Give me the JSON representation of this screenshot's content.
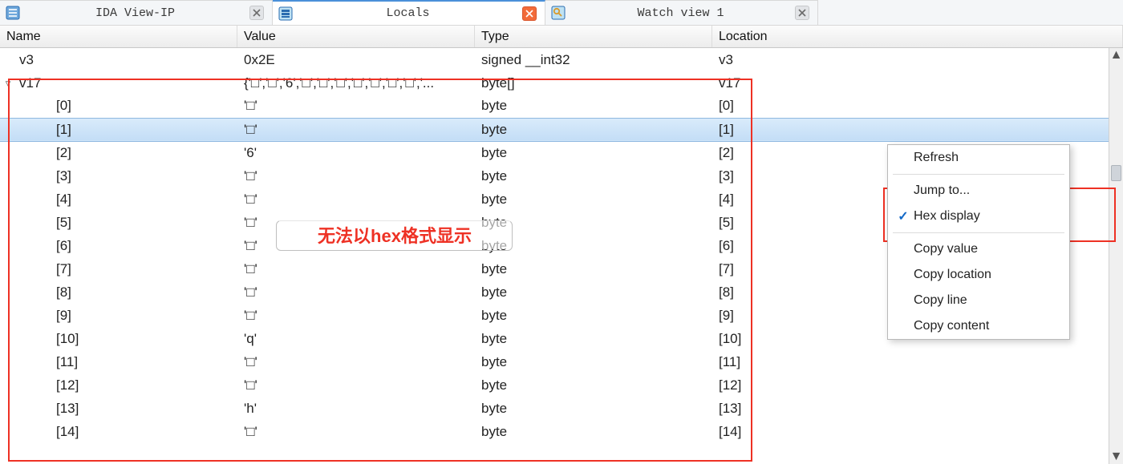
{
  "tabs": [
    {
      "label": "IDA View-IP",
      "icon": "list-icon",
      "close": "gray",
      "active": false
    },
    {
      "label": "Locals",
      "icon": "stack-icon",
      "close": "red",
      "active": true
    },
    {
      "label": "Watch view 1",
      "icon": "watch-icon",
      "close": "gray",
      "active": false
    }
  ],
  "columns": {
    "name": "Name",
    "value": "Value",
    "type": "Type",
    "location": "Location"
  },
  "rows": [
    {
      "indent": 0,
      "twist": "",
      "name": "v3",
      "value": "0x2E",
      "type": "signed __int32",
      "location": "v3",
      "selected": false
    },
    {
      "indent": 0,
      "twist": "▿",
      "name": "v17",
      "value": "{'□','□','6','□','□','□','□','□','□','□','...",
      "type": "byte[]",
      "location": "v17",
      "selected": false
    },
    {
      "indent": 1,
      "twist": "",
      "name": "[0]",
      "value": "'□'",
      "type": "byte",
      "location": "[0]",
      "selected": false
    },
    {
      "indent": 1,
      "twist": "",
      "name": "[1]",
      "value": "'□'",
      "type": "byte",
      "location": "[1]",
      "selected": true
    },
    {
      "indent": 1,
      "twist": "",
      "name": "[2]",
      "value": "'6'",
      "type": "byte",
      "location": "[2]",
      "selected": false
    },
    {
      "indent": 1,
      "twist": "",
      "name": "[3]",
      "value": "'□'",
      "type": "byte",
      "location": "[3]",
      "selected": false
    },
    {
      "indent": 1,
      "twist": "",
      "name": "[4]",
      "value": "'□'",
      "type": "byte",
      "location": "[4]",
      "selected": false
    },
    {
      "indent": 1,
      "twist": "",
      "name": "[5]",
      "value": "'□'",
      "type": "byte",
      "location": "[5]",
      "selected": false
    },
    {
      "indent": 1,
      "twist": "",
      "name": "[6]",
      "value": "'□'",
      "type": "byte",
      "location": "[6]",
      "selected": false
    },
    {
      "indent": 1,
      "twist": "",
      "name": "[7]",
      "value": "'□'",
      "type": "byte",
      "location": "[7]",
      "selected": false
    },
    {
      "indent": 1,
      "twist": "",
      "name": "[8]",
      "value": "'□'",
      "type": "byte",
      "location": "[8]",
      "selected": false
    },
    {
      "indent": 1,
      "twist": "",
      "name": "[9]",
      "value": "'□'",
      "type": "byte",
      "location": "[9]",
      "selected": false
    },
    {
      "indent": 1,
      "twist": "",
      "name": "[10]",
      "value": "'q'",
      "type": "byte",
      "location": "[10]",
      "selected": false
    },
    {
      "indent": 1,
      "twist": "",
      "name": "[11]",
      "value": "'□'",
      "type": "byte",
      "location": "[11]",
      "selected": false
    },
    {
      "indent": 1,
      "twist": "",
      "name": "[12]",
      "value": "'□'",
      "type": "byte",
      "location": "[12]",
      "selected": false
    },
    {
      "indent": 1,
      "twist": "",
      "name": "[13]",
      "value": "'h'",
      "type": "byte",
      "location": "[13]",
      "selected": false
    },
    {
      "indent": 1,
      "twist": "",
      "name": "[14]",
      "value": "'□'",
      "type": "byte",
      "location": "[14]",
      "selected": false
    }
  ],
  "context_menu": {
    "items": [
      {
        "label": "Refresh",
        "checked": false,
        "sep_after": true
      },
      {
        "label": "Jump to...",
        "checked": false,
        "sep_after": false
      },
      {
        "label": "Hex display",
        "checked": true,
        "sep_after": true
      },
      {
        "label": "Copy value",
        "checked": false,
        "sep_after": false
      },
      {
        "label": "Copy location",
        "checked": false,
        "sep_after": false
      },
      {
        "label": "Copy line",
        "checked": false,
        "sep_after": false
      },
      {
        "label": "Copy content",
        "checked": false,
        "sep_after": false
      }
    ]
  },
  "annotation": "无法以hex格式显示"
}
